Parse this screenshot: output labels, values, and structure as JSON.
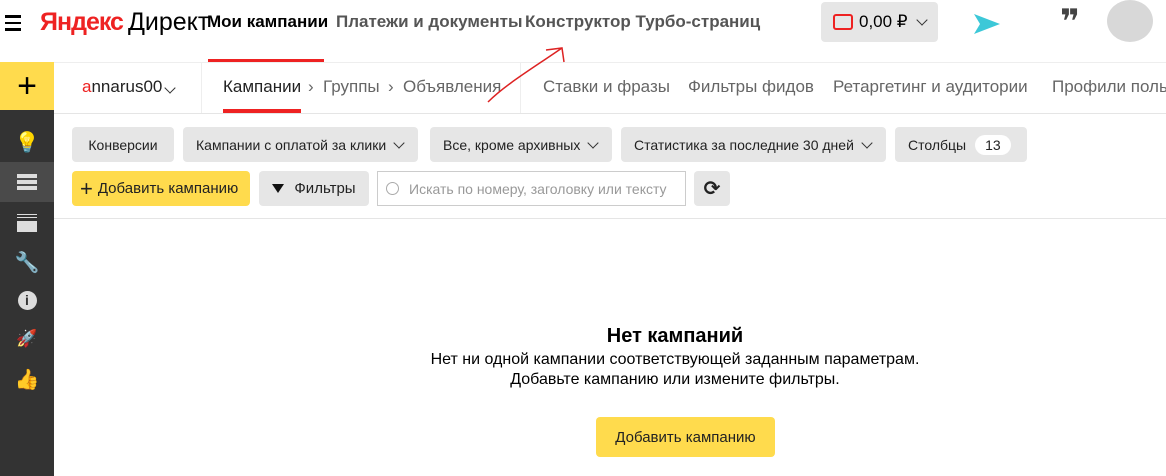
{
  "header": {
    "logo_yandex": "Яндекс",
    "logo_direct": "Директ",
    "nav": [
      "Мои кампании",
      "Платежи и документы",
      "Конструктор Турбо-страниц"
    ],
    "balance": "0,00 ₽"
  },
  "subnav": {
    "account_first": "a",
    "account_rest": "nnarus00",
    "crumbs": [
      "Кампании",
      "Группы",
      "Объявления"
    ],
    "tabs": [
      "Ставки и фразы",
      "Фильтры фидов",
      "Ретаргетинг и аудитории",
      "Профили поль"
    ]
  },
  "toolbar": {
    "conversions": "Конверсии",
    "payment": "Кампании с оплатой за клики",
    "archive": "Все, кроме архивных",
    "stats": "Статистика за последние 30 дней",
    "columns": "Столбцы",
    "columns_count": "13",
    "add": "Добавить кампанию",
    "filters": "Фильтры",
    "search_placeholder": "Искать по номеру, заголовку или тексту"
  },
  "empty": {
    "title": "Нет кампаний",
    "line1": "Нет ни одной кампании соответствующей заданным параметрам.",
    "line2": "Добавьте кампанию или измените фильтры.",
    "button": "Добавить кампанию"
  },
  "colors": {
    "accent": "#ffdb4d",
    "red": "#e22222",
    "sidebar": "#333333"
  }
}
